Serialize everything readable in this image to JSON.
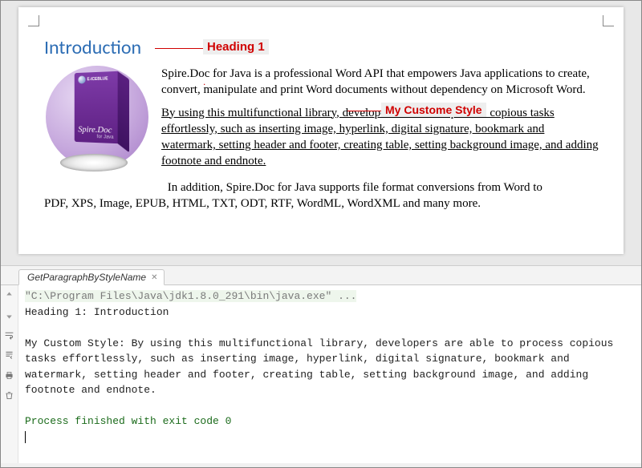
{
  "doc": {
    "heading": "Introduction",
    "heading_annot": "Heading 1",
    "custom_annot": "My Custome Style",
    "para1": "Spire.Doc for Java is a professional Word API that empowers Java applications to create, convert, manipulate and print Word documents without dependency on Microsoft Word.",
    "para2": "By using this multifunctional library, developers are able to process copious tasks effortlessly, such as inserting image, hyperlink, digital signature, bookmark and watermark, setting header and footer, creating table, setting background image, and adding footnote and endnote.",
    "para3_first": "In addition, Spire.Doc for Java supports file format conversions from Word to ",
    "para3_rest": "PDF, XPS, Image, EPUB, HTML, TXT, ODT, RTF, WordML, WordXML and many more.",
    "box": {
      "brand": "E-ICEBLUE",
      "title": "Spire.Doc",
      "subtitle": "for Java"
    }
  },
  "ide": {
    "tab": "GetParagraphByStyleName",
    "cmd": "\"C:\\Program Files\\Java\\jdk1.8.0_291\\bin\\java.exe\" ...",
    "out1": "Heading 1: Introduction",
    "out2": "My Custom Style: By using this multifunctional library, developers are able to process copious tasks effortlessly, such as inserting image, hyperlink, digital signature, bookmark and watermark, setting header and footer, creating table, setting background image, and adding footnote and endnote.",
    "exit": "Process finished with exit code 0"
  }
}
